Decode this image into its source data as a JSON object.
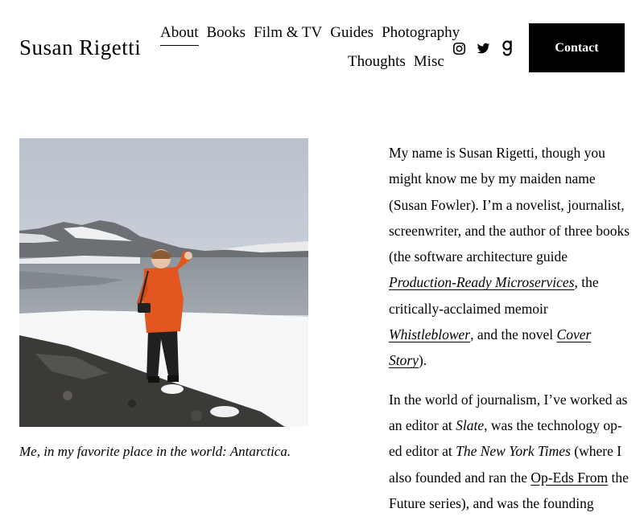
{
  "site": {
    "title": "Susan Rigetti"
  },
  "nav": {
    "row1": [
      "About",
      "Books",
      "Film & TV",
      "Guides",
      "Photography"
    ],
    "row2": [
      "Thoughts",
      "Misc"
    ],
    "active": "About"
  },
  "social": [
    "instagram-icon",
    "twitter-icon",
    "goodreads-icon"
  ],
  "contact": {
    "label": "Contact"
  },
  "photo": {
    "caption": "Me, in my favorite place in the world: Antarctica."
  },
  "bio": {
    "p1_a": "My name is Susan Rigetti, though you might know me by my maiden name (Susan Fowler). I’m a novelist, journalist, screenwriter, and the author of three books (the software architecture guide ",
    "p1_link1": "Production-Ready Microservices",
    "p1_b": ", the critically-acclaimed memoir ",
    "p1_link2": "Whistleblower",
    "p1_c": ", and the novel ",
    "p1_link3": "Cover Story",
    "p1_d": ").",
    "p2_a": "In the world of journalism, I’ve worked as an editor at ",
    "p2_slate": "Slate",
    "p2_b": ", was the technology op-ed editor at ",
    "p2_nyt": "The New York Times",
    "p2_c": " (where I also founded and ran the ",
    "p2_link": "Op-Eds From",
    "p2_d": " the Future series), and was the founding"
  },
  "colors": {
    "text": "#000000",
    "button_bg": "#000000",
    "button_text": "#ffffff",
    "background": "#ffffff"
  }
}
